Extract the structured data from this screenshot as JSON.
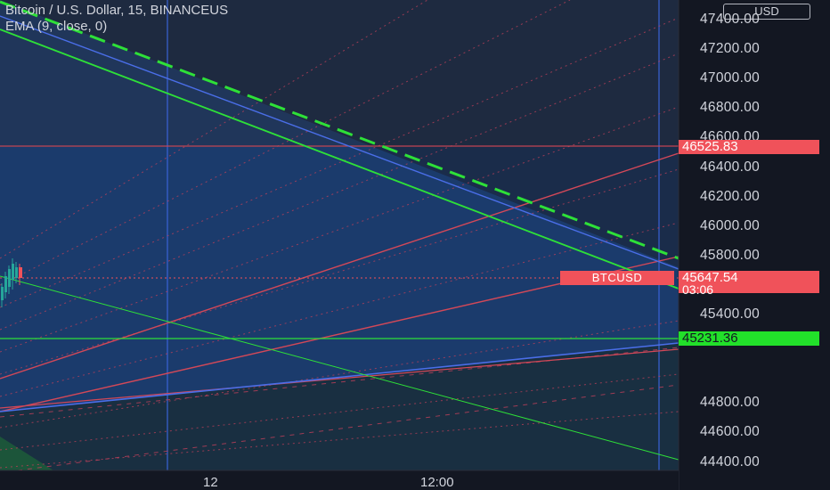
{
  "header": {
    "symbol_title": "Bitcoin / U.S. Dollar, 15, BINANCEUS",
    "indicator": "EMA (9, close, 0)",
    "currency": "USD"
  },
  "price_axis": {
    "labels": [
      "47400.00",
      "47200.00",
      "47000.00",
      "46800.00",
      "46600.00",
      "46400.00",
      "46200.00",
      "46000.00",
      "45800.00",
      "45400.00",
      "44800.00",
      "44600.00",
      "44400.00"
    ],
    "values": [
      47400,
      47200,
      47000,
      46800,
      46600,
      46400,
      46200,
      46000,
      45800,
      45400,
      44800,
      44600,
      44400
    ]
  },
  "price_tags": {
    "level_red": "46525.83",
    "last_price": "45647.54",
    "countdown": "03:06",
    "level_green": "45231.36",
    "symbol": "BTCUSD"
  },
  "time_axis": {
    "labels": [
      "12",
      "12:00"
    ]
  },
  "colors": {
    "background": "#131722",
    "blue_zone": "#1e3a64",
    "red": "#f0525a",
    "green": "#22e02a",
    "blue_line": "#3a63d8"
  }
}
